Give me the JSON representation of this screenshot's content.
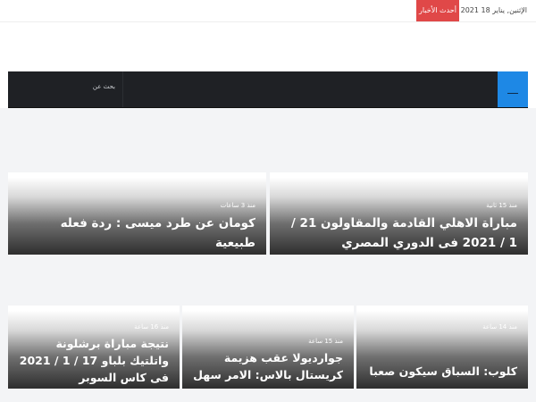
{
  "topbar": {
    "date": "الإثنين, يناير 18 2021",
    "breaking_label": "أحدث الأخبار"
  },
  "navbar": {
    "search_label": "بحث عن",
    "menu_icon": "hamburger-icon",
    "accent": "#1e88e5"
  },
  "featured": [
    {
      "time": "منذ 15 ثانية",
      "title": "مباراة الاهلي القادمة والمقاولون 21 / 1 / 2021 فى الدوري المصري"
    },
    {
      "time": "منذ 3 ساعات",
      "title": "كومان عن طرد ميسى : ردة فعله طبيعية"
    }
  ],
  "latest": [
    {
      "time": "منذ 14 ساعة",
      "title": "كلوب: السباق سيكون صعبا"
    },
    {
      "time": "منذ 15 ساعة",
      "title": "جوارديولا عقب هزيمة كريستال بالاس: الامر سهل"
    },
    {
      "time": "منذ 16 ساعة",
      "title": "نتيجة مباراة برشلونة واتلتيك بلباو 17 / 1 / 2021 فى كاس السوبر"
    }
  ]
}
